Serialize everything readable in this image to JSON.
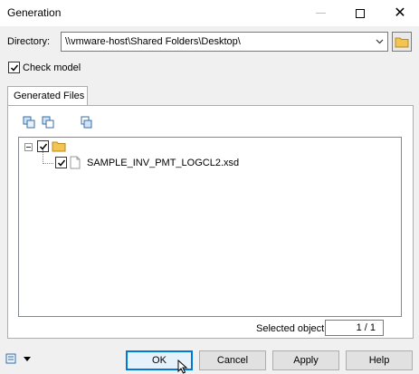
{
  "window": {
    "title": "Generation"
  },
  "titlebar": {
    "minimize_icon": "minimize-icon",
    "maximize_icon": "maximize-icon",
    "close_icon": "close-icon"
  },
  "directory": {
    "label": "Directory:",
    "value": "\\\\vmware-host\\Shared Folders\\Desktop\\"
  },
  "check_model": {
    "label": "Check model",
    "checked": true
  },
  "tabs": [
    {
      "label": "Generated Files",
      "selected": true
    }
  ],
  "tree": {
    "root": {
      "checked": true,
      "expanded": true,
      "icon": "folder-icon"
    },
    "items": [
      {
        "label": "SAMPLE_INV_PMT_LOGCL2.xsd",
        "checked": true,
        "icon": "file-icon"
      }
    ]
  },
  "selection": {
    "label": "Selected object(s):",
    "value": "1 / 1"
  },
  "buttons": {
    "ok": "OK",
    "cancel": "Cancel",
    "apply": "Apply",
    "help": "Help"
  },
  "colors": {
    "default_button_border": "#0078d7",
    "folder": "#f2c451"
  }
}
